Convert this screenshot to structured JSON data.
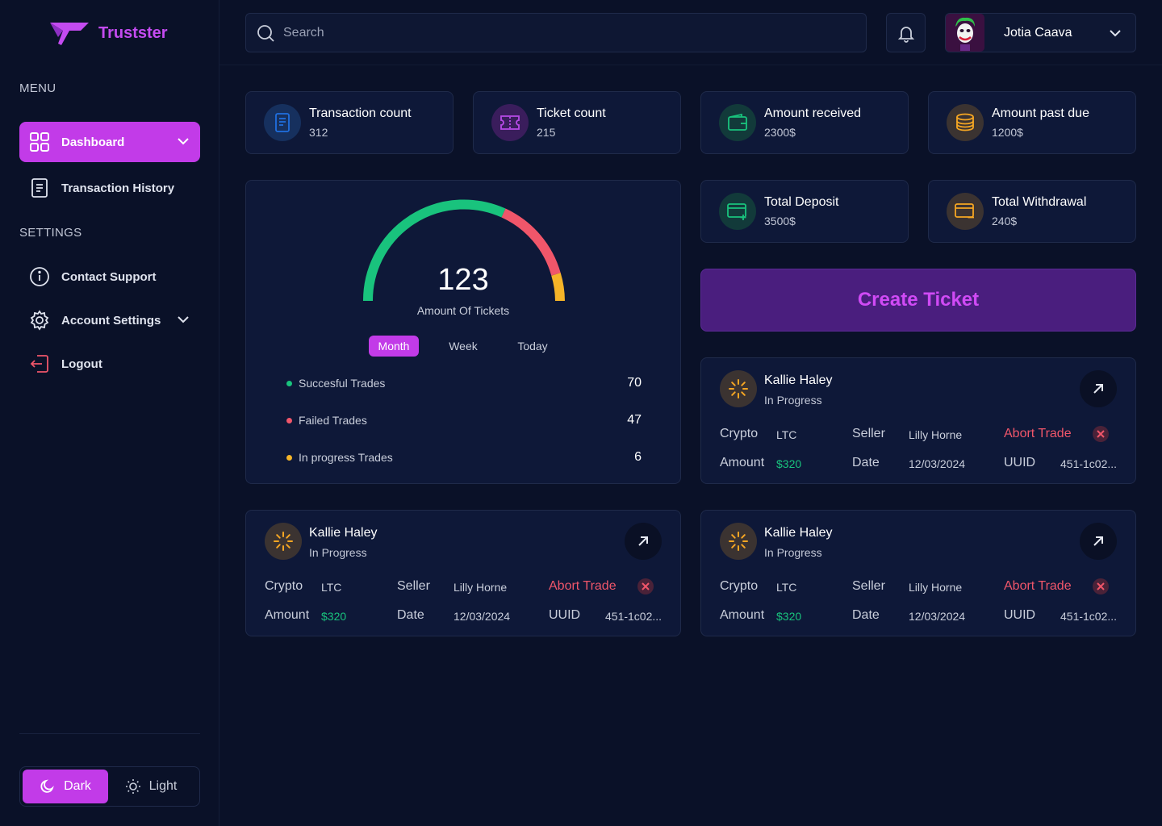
{
  "brand": {
    "name": "Trustster"
  },
  "sidebar": {
    "menu_label": "MENU",
    "settings_label": "SETTINGS",
    "items": [
      {
        "label": "Dashboard"
      },
      {
        "label": "Transaction History"
      },
      {
        "label": "Contact Support"
      },
      {
        "label": "Account Settings"
      },
      {
        "label": "Logout"
      }
    ],
    "theme": {
      "dark": "Dark",
      "light": "Light",
      "selected": "Dark"
    }
  },
  "header": {
    "search_placeholder": "Search",
    "user_name": "Jotia Caava"
  },
  "stats": [
    {
      "title": "Transaction count",
      "value": "312",
      "icon": "document-icon",
      "color": "#1f6fe0"
    },
    {
      "title": "Ticket count",
      "value": "215",
      "icon": "ticket-icon",
      "color": "#b84be8"
    },
    {
      "title": "Amount received",
      "value": "2300$",
      "icon": "wallet-icon",
      "color": "#19c37d"
    },
    {
      "title": "Amount past due",
      "value": "1200$",
      "icon": "coins-icon",
      "color": "#f5a623"
    },
    {
      "title": "Total Deposit",
      "value": "3500$",
      "icon": "card-plus-icon",
      "color": "#19c37d"
    },
    {
      "title": "Total Withdrawal",
      "value": "240$",
      "icon": "card-minus-icon",
      "color": "#f5a623"
    }
  ],
  "gauge": {
    "value": "123",
    "label": "Amount Of Tickets",
    "periods": [
      "Month",
      "Week",
      "Today"
    ],
    "selected_period": "Month",
    "trades": [
      {
        "label": "Succesful Trades",
        "value": "70",
        "color": "#19c37d"
      },
      {
        "label": "Failed Trades",
        "value": "47",
        "color": "#f0566a"
      },
      {
        "label": "In progress Trades",
        "value": "6",
        "color": "#f5b428"
      }
    ]
  },
  "create_ticket_label": "Create Ticket",
  "trade_cards": [
    {
      "name": "Kallie Haley",
      "status": "In Progress",
      "crypto_label": "Crypto",
      "crypto": "LTC",
      "seller_label": "Seller",
      "seller": "Lilly Horne",
      "abort_label": "Abort Trade",
      "amount_label": "Amount",
      "amount": "$320",
      "date_label": "Date",
      "date": "12/03/2024",
      "uuid_label": "UUID",
      "uuid": "451-1c02..."
    },
    {
      "name": "Kallie Haley",
      "status": "In Progress",
      "crypto_label": "Crypto",
      "crypto": "LTC",
      "seller_label": "Seller",
      "seller": "Lilly Horne",
      "abort_label": "Abort Trade",
      "amount_label": "Amount",
      "amount": "$320",
      "date_label": "Date",
      "date": "12/03/2024",
      "uuid_label": "UUID",
      "uuid": "451-1c02..."
    },
    {
      "name": "Kallie Haley",
      "status": "In Progress",
      "crypto_label": "Crypto",
      "crypto": "LTC",
      "seller_label": "Seller",
      "seller": "Lilly Horne",
      "abort_label": "Abort Trade",
      "amount_label": "Amount",
      "amount": "$320",
      "date_label": "Date",
      "date": "12/03/2024",
      "uuid_label": "UUID",
      "uuid": "451-1c02..."
    }
  ]
}
